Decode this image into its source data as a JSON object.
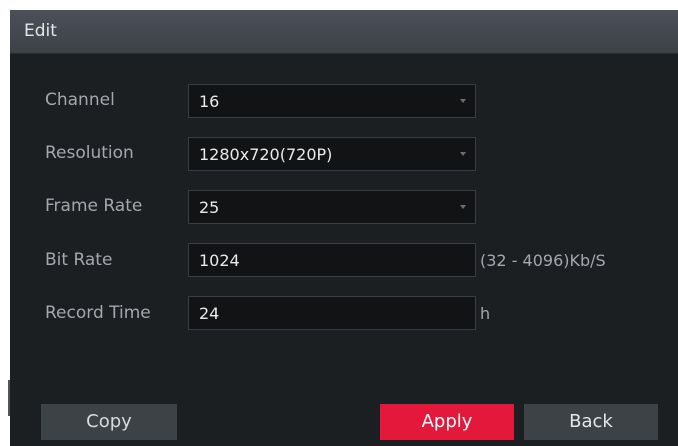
{
  "dialog": {
    "title": "Edit",
    "fields": [
      {
        "label": "Channel",
        "value": "16",
        "type": "dropdown"
      },
      {
        "label": "Resolution",
        "value": "1280x720(720P)",
        "type": "dropdown"
      },
      {
        "label": "Frame Rate",
        "value": "25",
        "type": "dropdown"
      },
      {
        "label": "Bit Rate",
        "value": "1024",
        "type": "input",
        "unit": "(32 - 4096)Kb/S"
      },
      {
        "label": "Record Time",
        "value": "24",
        "type": "input",
        "unit": "h"
      }
    ],
    "buttons": {
      "copy": "Copy",
      "apply": "Apply",
      "back": "Back"
    }
  },
  "colors": {
    "accent": "#e3183a",
    "background": "#1c1f22",
    "title_bar": "#43484d"
  },
  "icons": [
    "dropdown-arrow-icon"
  ]
}
